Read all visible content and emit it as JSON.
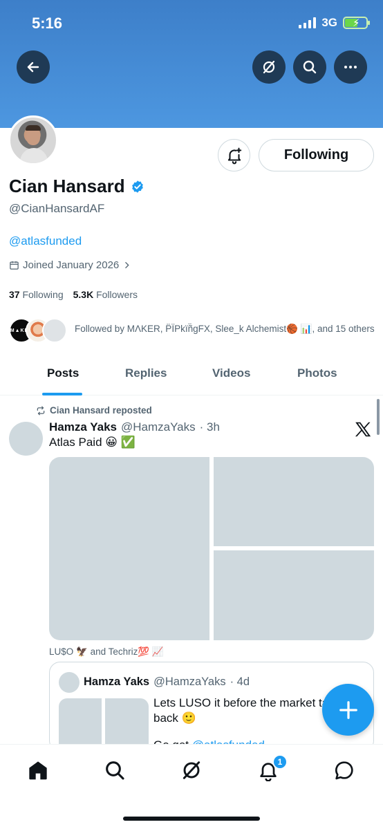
{
  "status_bar": {
    "time": "5:16",
    "network": "3G"
  },
  "profile": {
    "name": "Cian Hansard",
    "handle": "@CianHansardAF",
    "bio_link": "@atlasfunded",
    "joined": "Joined January 2026",
    "following_count": "37",
    "following_label": "Following",
    "followers_count": "5.3K",
    "followers_label": "Followers",
    "follow_button": "Following",
    "followed_by_avatar_text": "M▲KER",
    "followed_by": "Followed by MΛKER, P̈ÏPkïñ̈gFX, Slee_k Alchemist🏀 📊, and 15 others"
  },
  "tabs": [
    {
      "label": "Posts"
    },
    {
      "label": "Replies"
    },
    {
      "label": "Videos"
    },
    {
      "label": "Photos"
    }
  ],
  "post": {
    "repost_label": "Cian Hansard reposted",
    "author": "Hamza Yaks",
    "handle": "@HamzaYaks",
    "time": "· 3h",
    "text": "Atlas Paid 😀 ✅",
    "tagged": "LU$O 🦅 and Techriz💯 📈"
  },
  "quote": {
    "author": "Hamza Yaks",
    "handle": "@HamzaYaks",
    "time": "· 4d",
    "text": "Lets LUSO it before the market takes it back 🙂",
    "text2_prefix": "Go get",
    "text2_link": "@atlasfunded"
  },
  "badges": {
    "notifications": "1"
  },
  "colors": {
    "accent": "#1d9bf0",
    "banner": "#4a8fd8",
    "text": "#0f1419",
    "muted": "#536471"
  }
}
